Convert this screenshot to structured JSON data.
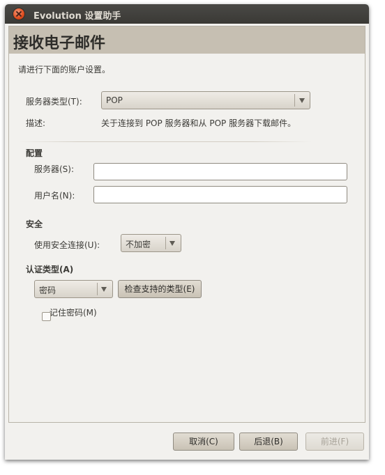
{
  "window": {
    "title": "Evolution 设置助手"
  },
  "page": {
    "title": "接收电子邮件",
    "intro": "请进行下面的账户设置。"
  },
  "server_type": {
    "label": "服务器类型(T):",
    "value": "POP",
    "desc_label": "描述:",
    "desc_text": "关于连接到 POP 服务器和从 POP 服务器下载邮件。"
  },
  "config": {
    "heading": "配置",
    "server_label": "服务器(S):",
    "server_value": "",
    "username_label": "用户名(N):",
    "username_value": ""
  },
  "security": {
    "heading": "安全",
    "label": "使用安全连接(U):",
    "value": "不加密"
  },
  "auth": {
    "heading": "认证类型(A)",
    "value": "密码",
    "check_button": "检查支持的类型(E)",
    "remember_label": "记住密码(M)",
    "remember_checked": false
  },
  "buttons": {
    "cancel": "取消(C)",
    "back": "后退(B)",
    "forward": "前进(F)"
  }
}
